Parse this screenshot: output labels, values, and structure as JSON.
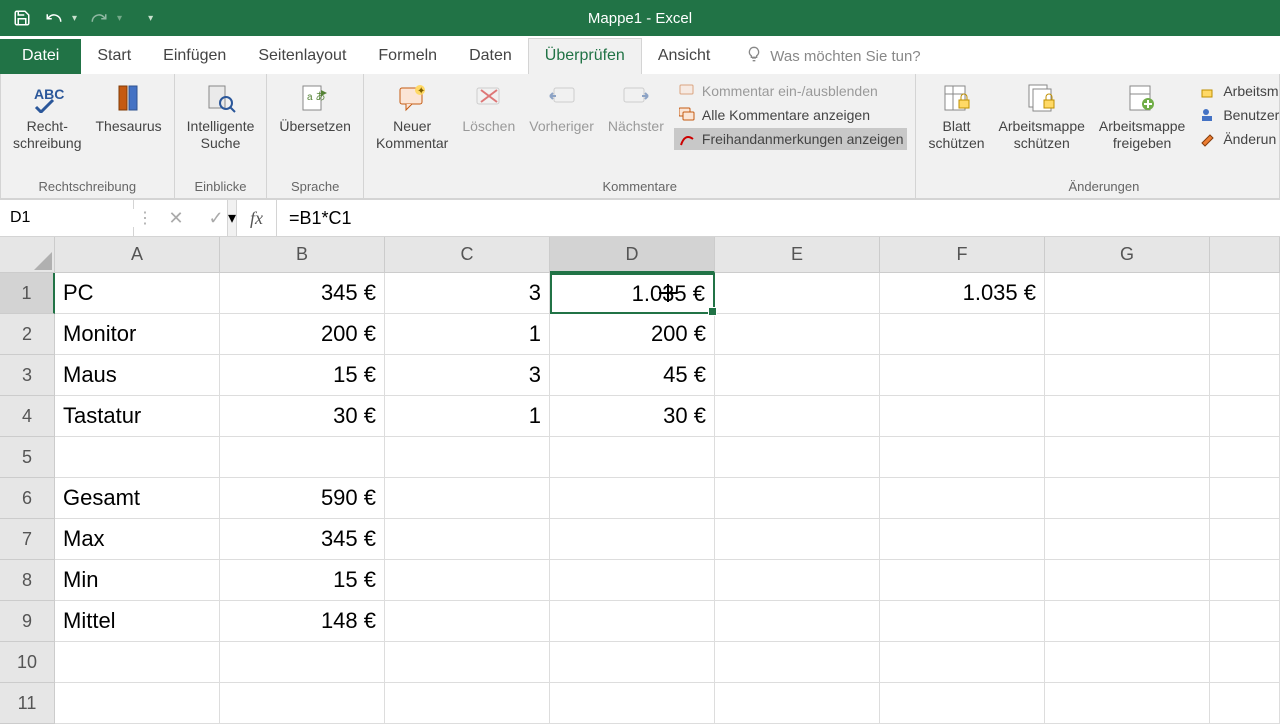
{
  "titlebar": {
    "title": "Mappe1 - Excel"
  },
  "tabs": {
    "file": "Datei",
    "home": "Start",
    "insert": "Einfügen",
    "layout": "Seitenlayout",
    "formulas": "Formeln",
    "data": "Daten",
    "review": "Überprüfen",
    "view": "Ansicht",
    "tellme": "Was möchten Sie tun?"
  },
  "ribbon": {
    "proofing": {
      "label": "Rechtschreibung",
      "spelling_line1": "Recht-",
      "spelling_line2": "schreibung",
      "thesaurus": "Thesaurus"
    },
    "insights": {
      "label": "Einblicke",
      "smart_line1": "Intelligente",
      "smart_line2": "Suche"
    },
    "language": {
      "label": "Sprache",
      "translate": "Übersetzen"
    },
    "comments": {
      "label": "Kommentare",
      "new_line1": "Neuer",
      "new_line2": "Kommentar",
      "delete": "Löschen",
      "prev": "Vorheriger",
      "next": "Nächster",
      "toggle": "Kommentar ein-/ausblenden",
      "showall": "Alle Kommentare anzeigen",
      "ink": "Freihandanmerkungen anzeigen"
    },
    "changes": {
      "label": "Änderungen",
      "protect_sheet_line1": "Blatt",
      "protect_sheet_line2": "schützen",
      "protect_wb_line1": "Arbeitsmappe",
      "protect_wb_line2": "schützen",
      "share_line1": "Arbeitsmappe",
      "share_line2": "freigeben",
      "protectshare": "Arbeitsm",
      "allowusers": "Benutzer",
      "track": "Änderun"
    }
  },
  "namebox": "D1",
  "formula": "=B1*C1",
  "columns": [
    "A",
    "B",
    "C",
    "D",
    "E",
    "F",
    "G"
  ],
  "rows": [
    "1",
    "2",
    "3",
    "4",
    "5",
    "6",
    "7",
    "8",
    "9",
    "10",
    "11"
  ],
  "cells": {
    "A1": "PC",
    "B1": "345 €",
    "C1": "3",
    "D1": "1.035 €",
    "F1": "1.035 €",
    "A2": "Monitor",
    "B2": "200 €",
    "C2": "1",
    "D2": "200 €",
    "A3": "Maus",
    "B3": "15 €",
    "C3": "3",
    "D3": "45 €",
    "A4": "Tastatur",
    "B4": "30 €",
    "C4": "1",
    "D4": "30 €",
    "A6": "Gesamt",
    "B6": "590 €",
    "A7": "Max",
    "B7": "345 €",
    "A8": "Min",
    "B8": "15 €",
    "A9": "Mittel",
    "B9": "148 €"
  },
  "selected": {
    "col": "D",
    "row": "1"
  }
}
